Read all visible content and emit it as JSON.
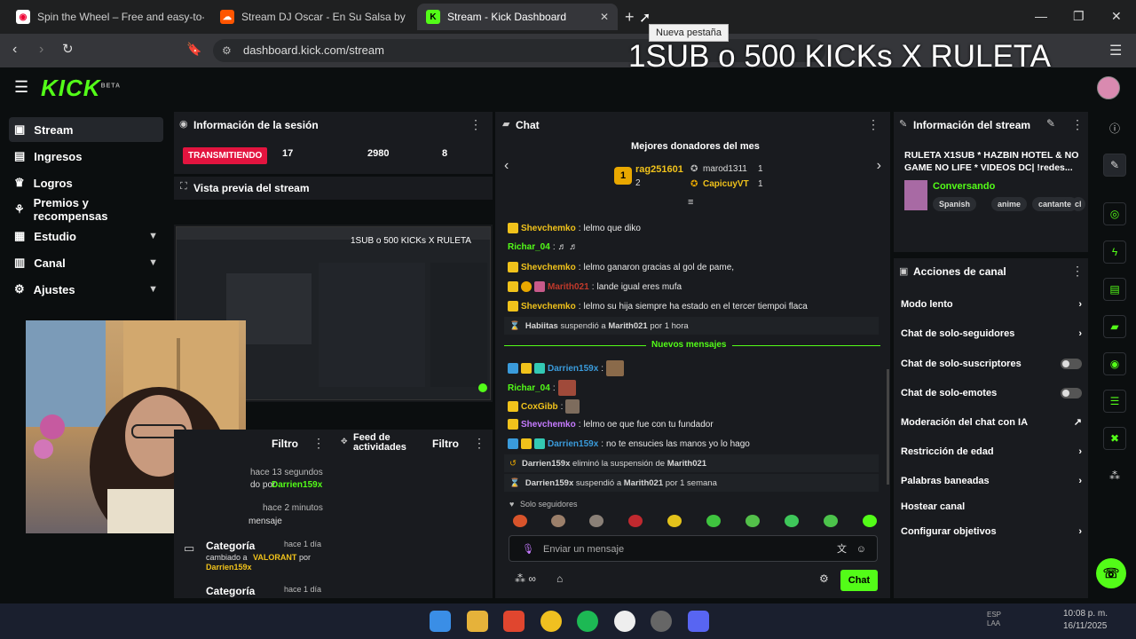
{
  "browser": {
    "tabs": [
      {
        "title": "Spin the Wheel – Free and easy-to-us"
      },
      {
        "title": "Stream DJ Oscar - En Su Salsa by DJO"
      },
      {
        "title": "Stream - Kick Dashboard"
      }
    ],
    "new_tab_tooltip": "Nueva pestaña",
    "url": "dashboard.kick.com/stream",
    "overlay_title": "1SUB o 500 KICKs X RULETA"
  },
  "kick": {
    "logo": "KICK",
    "logo_beta": "BETA"
  },
  "sidebar": {
    "items": [
      {
        "label": "Stream"
      },
      {
        "label": "Ingresos"
      },
      {
        "label": "Logros"
      },
      {
        "label": "Premios y recompensas"
      },
      {
        "label": "Estudio"
      },
      {
        "label": "Canal"
      },
      {
        "label": "Ajustes"
      }
    ]
  },
  "session": {
    "title": "Información de la sesión",
    "status": "TRANSMITIENDO",
    "stats": [
      "17",
      "2980",
      "8"
    ]
  },
  "preview": {
    "title": "Vista previa del stream",
    "overlay_text": "1SUB o 500 KICKs X RULETA"
  },
  "activity": {
    "filter1": "Filtro",
    "feed_title": "Feed de actividades",
    "filter2": "Filtro",
    "frag1_time": "hace 13 segundos",
    "frag1_text": "do por",
    "frag1_user": "Darrien159x",
    "frag2_time": "hace 2 minutos",
    "frag2_text": "mensaje",
    "cat1_title": "Categoría",
    "cat1_time": "hace 1 día",
    "cat1_text_a": "cambiado a",
    "cat1_value": "VALORANT",
    "cat1_text_b": "por",
    "cat1_user": "Darrien159x",
    "cat2_title": "Categoría",
    "cat2_time": "hace 1 día"
  },
  "chat": {
    "title": "Chat",
    "donors_title": "Mejores donadores del mes",
    "donors": [
      {
        "rank": "1",
        "name": "rag251601",
        "count": "2"
      },
      {
        "name": "marod1311",
        "count": "1"
      },
      {
        "name": "CapicuyVT",
        "count": "1"
      }
    ],
    "messages": [
      {
        "user": "Shevchemko",
        "text": "lelmo que diko"
      },
      {
        "user": "Richar_04",
        "text": ""
      },
      {
        "user": "Shevchemko",
        "text": "lelmo ganaron gracias al gol de pame,"
      },
      {
        "user": "Marith021",
        "text": "lande igual eres mufa"
      },
      {
        "user": "Shevchemko",
        "text": "lelmo su hija siempre ha estado en el tercer tiempoi flaca"
      }
    ],
    "sys1": {
      "user": "Habiitas",
      "mid": "suspendió a",
      "target": "Marith021",
      "tail": "por 1 hora"
    },
    "new_messages": "Nuevos mensajes",
    "messages2": [
      {
        "user": "Darrien159x",
        "text": ""
      },
      {
        "user": "Richar_04",
        "text": ""
      },
      {
        "user": "CoxGibb",
        "text": ""
      },
      {
        "user": "Shevchemko",
        "text": "lelmo oe que fue con tu fundador"
      },
      {
        "user": "Darrien159x",
        "text": "no te ensucies las manos yo lo hago"
      }
    ],
    "sys2": {
      "user": "Darrien159x",
      "mid": "eliminó la suspensión de",
      "target": "Marith021"
    },
    "sys3": {
      "user": "Darrien159x",
      "mid": "suspendió a",
      "target": "Marith021",
      "tail": "por 1 semana"
    },
    "followers_only": "Solo seguidores",
    "input_placeholder": "Enviar un mensaje",
    "send_label": "Chat"
  },
  "stream_info": {
    "title": "Información del stream",
    "stream_title": "RULETA X1SUB * HAZBIN HOTEL & NO GAME NO LIFE * VIDEOS DC| !redes...",
    "category": "Conversando",
    "tags": [
      "Spanish",
      "anime",
      "cantante",
      "cl"
    ]
  },
  "channel_actions": {
    "title": "Acciones de canal",
    "items": [
      {
        "label": "Modo lento"
      },
      {
        "label": "Chat de solo-seguidores"
      },
      {
        "label": "Chat de solo-suscriptores"
      },
      {
        "label": "Chat de solo-emotes"
      },
      {
        "label": "Moderación del chat con IA"
      },
      {
        "label": "Restricción de edad"
      },
      {
        "label": "Palabras baneadas"
      },
      {
        "label": "Hostear canal"
      },
      {
        "label": "Configurar objetivos"
      }
    ]
  },
  "taskbar": {
    "clock_time": "10:08 p. m.",
    "clock_date": "16/11/2025",
    "lang": "ESP LAA"
  },
  "colors": {
    "accent": "#53fc18",
    "live": "#e3143f",
    "panel": "#191b1f",
    "bg": "#0b0e0f",
    "username_yellow": "#f0c21b",
    "username_purple": "#c67bff",
    "username_blue": "#3a9bdb",
    "username_green": "#53fc18"
  }
}
